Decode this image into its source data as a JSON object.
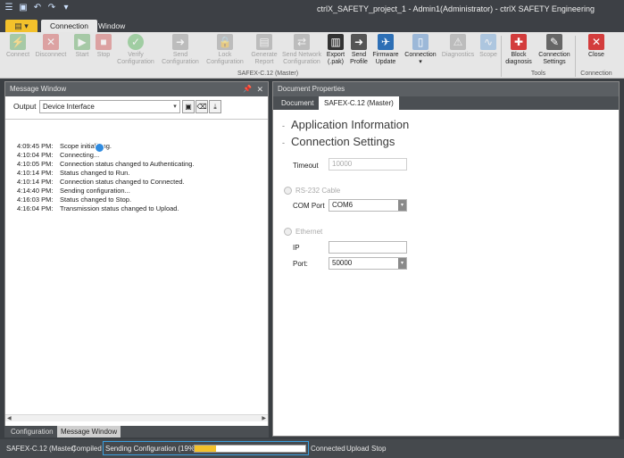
{
  "window": {
    "title": "ctrlX_SAFETY_project_1 - Admin1(Administrator) - ctrlX SAFETY Engineering"
  },
  "ribbon_tabs": [
    "Connection",
    "Window"
  ],
  "ribbon": {
    "buttons": [
      {
        "label": "Connect",
        "icon": "plug-icon"
      },
      {
        "label": "Disconnect",
        "icon": "unplug-icon"
      },
      {
        "label": "Start",
        "icon": "play-icon"
      },
      {
        "label": "Stop",
        "icon": "stop-icon"
      },
      {
        "label": "Verify Configuration",
        "icon": "check-circle-icon"
      },
      {
        "label": "Send Configuration",
        "icon": "send-icon"
      },
      {
        "label": "Lock Configuration",
        "icon": "lock-icon"
      },
      {
        "label": "Generate Report",
        "icon": "report-icon"
      },
      {
        "label": "Send Network Configuration",
        "icon": "network-icon"
      },
      {
        "label": "Export (.pak)",
        "icon": "barcode-icon"
      },
      {
        "label": "Send Profile",
        "icon": "send-profile-icon"
      },
      {
        "label": "Firmware Update",
        "icon": "firmware-icon"
      },
      {
        "label": "Connection",
        "icon": "connection-icon"
      },
      {
        "label": "Diagnostics",
        "icon": "diagnostics-icon"
      },
      {
        "label": "Scope",
        "icon": "scope-icon"
      },
      {
        "label": "Block diagnosis",
        "icon": "block-diagnosis-icon"
      },
      {
        "label": "Connection Settings",
        "icon": "wrench-icon"
      },
      {
        "label": "Close",
        "icon": "close-icon"
      }
    ],
    "groups": {
      "main": "SAFEX-C.12 (Master)",
      "tools": "Tools",
      "connection": "Connection"
    }
  },
  "message_window": {
    "title": "Message Window",
    "output_label": "Output",
    "output_value": "Device Interface",
    "log": [
      {
        "time": "4:09:45 PM:",
        "msg": "Scope initializing."
      },
      {
        "time": "4:10:04 PM:",
        "msg": "Connecting..."
      },
      {
        "time": "4:10:05 PM:",
        "msg": "Connection status changed to Authenticating."
      },
      {
        "time": "4:10:14 PM:",
        "msg": "Status changed to Run."
      },
      {
        "time": "4:10:14 PM:",
        "msg": "Connection status changed to Connected."
      },
      {
        "time": "4:14:40 PM:",
        "msg": "Sending configuration..."
      },
      {
        "time": "4:16:03 PM:",
        "msg": "Status changed to Stop."
      },
      {
        "time": "4:16:04 PM:",
        "msg": "Transmission status changed to Upload."
      }
    ]
  },
  "bottom_tabs": [
    "Configuration",
    "Message Window"
  ],
  "document_properties": {
    "title": "Document Properties",
    "tabs": [
      "Document",
      "SAFEX-C.12 (Master)"
    ],
    "sections": [
      "Application Information",
      "Connection Settings"
    ],
    "timeout_label": "Timeout",
    "timeout_value": "10000",
    "rs232_label": "RS-232 Cable",
    "com_port_label": "COM Port",
    "com_port_value": "COM6",
    "ethernet_label": "Ethernet",
    "ip_label": "IP",
    "ip_value": "",
    "port_label": "Port:",
    "port_value": "50000"
  },
  "status": {
    "device": "SAFEX-C.12 (Master)",
    "compiled": "Compiled",
    "sending": "Sending Configuration (19%)",
    "progress_fraction": 0.19,
    "connected": "Connected",
    "upload": "Upload",
    "stop": "Stop"
  },
  "colors": {
    "accent": "#f3c12b",
    "highlight": "#3aa0e0"
  }
}
